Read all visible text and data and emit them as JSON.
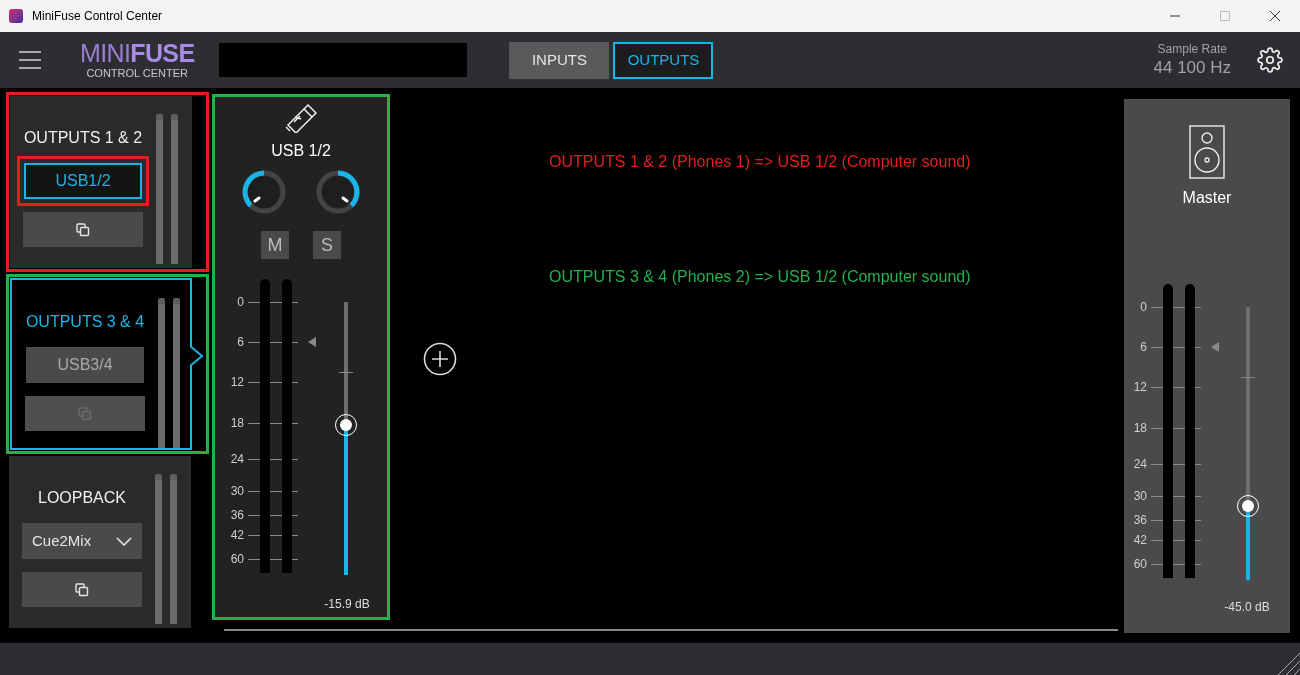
{
  "window": {
    "title": "MiniFuse Control Center"
  },
  "header": {
    "logo": {
      "brand_a": "MINI",
      "brand_b": "FUSE",
      "subtitle": "CONTROL CENTER"
    },
    "tabs": [
      {
        "label": "INPUTS",
        "selected": false
      },
      {
        "label": "OUTPUTS",
        "selected": true
      }
    ],
    "sample_rate": {
      "label": "Sample Rate",
      "value": "44 100 Hz"
    }
  },
  "outputs": [
    {
      "title": "OUTPUTS 1 & 2",
      "selected": false,
      "color": "#e81c1c",
      "source": {
        "kind": "button",
        "label": "USB1/2",
        "selected": true,
        "color": "#e81c1c"
      },
      "copy": {
        "disabled": false
      }
    },
    {
      "title": "OUTPUTS 3 & 4",
      "selected": true,
      "color": "#22b14c",
      "source": {
        "kind": "button",
        "label": "USB3/4",
        "selected": false
      },
      "copy": {
        "disabled": true
      }
    },
    {
      "title": "LOOPBACK",
      "selected": false,
      "source": {
        "kind": "dropdown",
        "label": "Cue2Mix"
      },
      "copy": {
        "disabled": false
      }
    }
  ],
  "strip": {
    "name": "USB 1/2",
    "color": "#22b14c",
    "mute": "M",
    "solo": "S",
    "scale": [
      "0",
      "6",
      "12",
      "18",
      "24",
      "30",
      "36",
      "42",
      "60"
    ],
    "fader": {
      "level": 0.55
    },
    "reading": "-15.9 dB"
  },
  "notes": [
    {
      "text": "OUTPUTS 1 & 2 (Phones 1) => USB 1/2 (Computer sound)",
      "color": "#e81c1c"
    },
    {
      "text": "OUTPUTS 3 & 4 (Phones 2) => USB 1/2 (Computer sound)",
      "color": "#22b14c"
    }
  ],
  "master": {
    "name": "Master",
    "scale": [
      "0",
      "6",
      "12",
      "18",
      "24",
      "30",
      "36",
      "42",
      "60"
    ],
    "fader": {
      "level": 0.27
    },
    "reading": "-45.0 dB"
  }
}
